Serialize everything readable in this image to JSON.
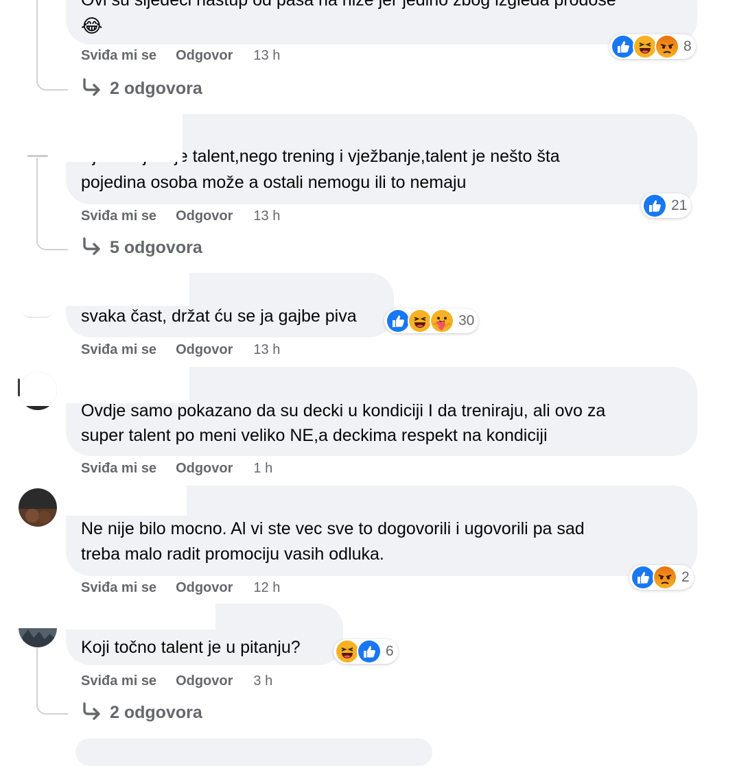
{
  "comments": [
    {
      "lines": [
        "Ovi su sljedeći nastup od pasa na niže jer jedino zbog izgleda prodoše",
        "😂"
      ],
      "like": "Sviđa mi se",
      "reply": "Odgovor",
      "time": "13 h",
      "reactions": {
        "icons": [
          "like-icon",
          "haha-icon",
          "angry-icon"
        ],
        "count": "8"
      },
      "replies": "2 odgovora"
    },
    {
      "lines": [
        "Vježbanje nije talent,nego trening i vježbanje,talent je nešto šta",
        "pojedina osoba može a ostali nemogu ili to nemaju"
      ],
      "like": "Sviđa mi se",
      "reply": "Odgovor",
      "time": "13 h",
      "reactions": {
        "icons": [
          "like-icon"
        ],
        "count": "21"
      },
      "replies": "5 odgovora"
    },
    {
      "lines": [
        "svaka čast, držat ću se ja gajbe piva"
      ],
      "like": "Sviđa mi se",
      "reply": "Odgovor",
      "time": "13 h",
      "reactions": {
        "icons": [
          "like-icon",
          "haha-icon",
          "care-icon"
        ],
        "count": "30"
      }
    },
    {
      "lines": [
        "Ovdje samo pokazano da su decki u kondiciji I da treniraju, ali ovo za",
        "super talent po meni veliko NE,a deckima respekt na kondiciji"
      ],
      "like": "Sviđa mi se",
      "reply": "Odgovor",
      "time": "1 h"
    },
    {
      "lines": [
        "Ne nije bilo mocno. Al vi ste vec sve to dogovorili i ugovorili pa sad",
        "treba malo radit promociju vasih odluka."
      ],
      "like": "Sviđa mi se",
      "reply": "Odgovor",
      "time": "12 h",
      "reactions": {
        "icons": [
          "like-icon",
          "angry-icon"
        ],
        "count": "2"
      }
    },
    {
      "lines": [
        "Koji točno talent je u pitanju?"
      ],
      "like": "Sviđa mi se",
      "reply": "Odgovor",
      "time": "3 h",
      "reactions": {
        "icons": [
          "haha-icon",
          "like-icon"
        ],
        "count": "6"
      },
      "replies": "2 odgovora"
    }
  ],
  "colors": {
    "bubble": "#f0f2f5",
    "meta_text": "#65676b",
    "like_blue": "#1877f2",
    "haha_yellow": "#f7b125",
    "angry_orange": "#e9710f"
  }
}
